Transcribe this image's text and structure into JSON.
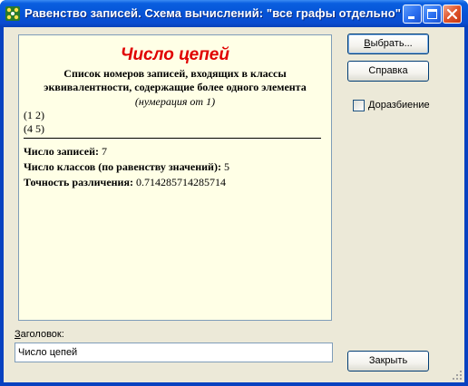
{
  "window": {
    "title": "Равенство записей. Схема вычислений: \"все графы отдельно\""
  },
  "report": {
    "heading": "Число цепей",
    "subtitle": "Список номеров записей, входящих в классы эквивалентности, содержащие более одного элемента",
    "note": "(нумерация от 1)",
    "groups": [
      "(1 2)",
      "(4 5)"
    ],
    "stats": [
      {
        "label": "Число записей:",
        "value": " 7"
      },
      {
        "label": "Число классов (по равенству значений):",
        "value": " 5"
      },
      {
        "label": "Точность различения:",
        "value": " 0.714285714285714"
      }
    ]
  },
  "caption": {
    "label_mnemonic": "З",
    "label_rest": "аголовок:",
    "value": "Число цепей"
  },
  "buttons": {
    "select_mnemonic": "В",
    "select_rest": "ыбрать...",
    "help": "Справка",
    "close": "Закрыть"
  },
  "options": {
    "subdivide_mnemonic": "Д",
    "subdivide_rest": "оразбиение",
    "subdivide_checked": false
  },
  "colors": {
    "titlebar": "#0553d6",
    "report_bg": "#ffffe6",
    "heading": "#e00000",
    "dialog_bg": "#ece9d8"
  }
}
